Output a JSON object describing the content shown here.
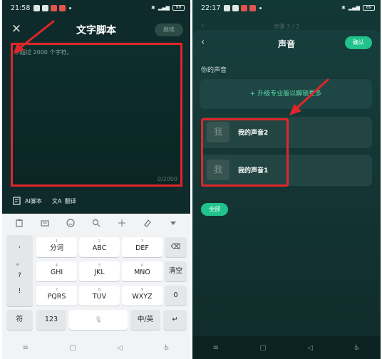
{
  "left": {
    "status": {
      "time": "21:58",
      "battery": "99"
    },
    "header": {
      "close": "✕",
      "title": "文字脚本",
      "continue_label": "继续"
    },
    "editor": {
      "placeholder": "不超过 2000 个字符。",
      "value": "",
      "count": "0/2000"
    },
    "tools": {
      "ai_script": "AI脚本",
      "translate": "翻译"
    },
    "keyboard": {
      "punctuation": [
        ",",
        "。",
        "?",
        "!"
      ],
      "row1": [
        {
          "sub": "1",
          "main": "分词"
        },
        {
          "sub": "2",
          "main": "ABC"
        },
        {
          "sub": "3",
          "main": "DEF"
        }
      ],
      "row2": [
        {
          "sub": "4",
          "main": "GHI"
        },
        {
          "sub": "5",
          "main": "JKL"
        },
        {
          "sub": "6",
          "main": "MNO"
        }
      ],
      "row3": [
        {
          "sub": "7",
          "main": "PQRS"
        },
        {
          "sub": "8",
          "main": "TUV"
        },
        {
          "sub": "9",
          "main": "WXYZ"
        }
      ],
      "clear": "清空",
      "zero": "0",
      "symbol": "符",
      "num": "123",
      "lang": "中/英",
      "backspace": "⌫",
      "enter": "↵",
      "mic": "🎙"
    },
    "nav": [
      "≡",
      "▢",
      "◁",
      "♿"
    ]
  },
  "right": {
    "status": {
      "time": "22:17",
      "battery": "89"
    },
    "step": "步骤 2 / 2",
    "sheet": {
      "back": "‹",
      "title": "声音",
      "confirm_label": "确认",
      "section_label": "你的声音",
      "upgrade_label": "+ 升级专业版以解锁更多",
      "voices": [
        {
          "avatar": "我",
          "name": "我的声音2"
        },
        {
          "avatar": "我",
          "name": "我的声音1"
        }
      ],
      "all_label": "全部"
    },
    "nav": [
      "≡",
      "▢",
      "◁",
      "♿"
    ]
  },
  "colors": {
    "accent": "#1fc38b",
    "highlight": "#e0262b",
    "background": "#0f2a2a"
  }
}
